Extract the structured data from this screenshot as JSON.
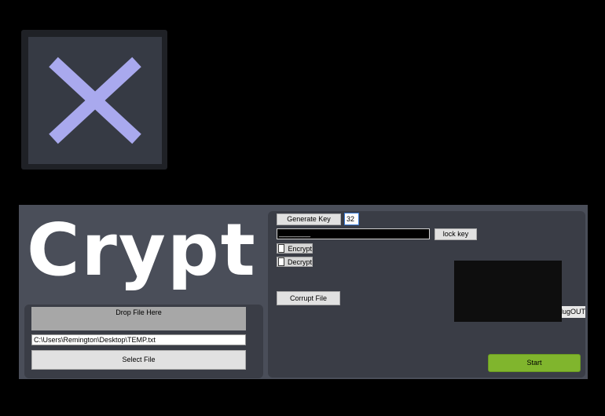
{
  "app": {
    "title": "Crypt"
  },
  "file_panel": {
    "drop_label": "Drop File Here",
    "file_path": "C:\\Users\\Remington\\Desktop\\TEMP.txt",
    "select_label": "Select File"
  },
  "key_panel": {
    "generate_label": "Generate Key",
    "key_length": "32",
    "key_value": "________",
    "lock_label": "lock key",
    "encrypt_label": "Encrypt",
    "decrypt_label": "Decrypt",
    "corrupt_label": "Corrupt File",
    "plugout_label": "PlugOUT",
    "start_label": "Start"
  },
  "colors": {
    "accent_start": "#80b52d",
    "logo_cross": "#a9a9ee",
    "panel_bg": "#3a3d46",
    "window_bg": "#4a4e59"
  },
  "icons": {
    "logo": "close-x-icon"
  }
}
